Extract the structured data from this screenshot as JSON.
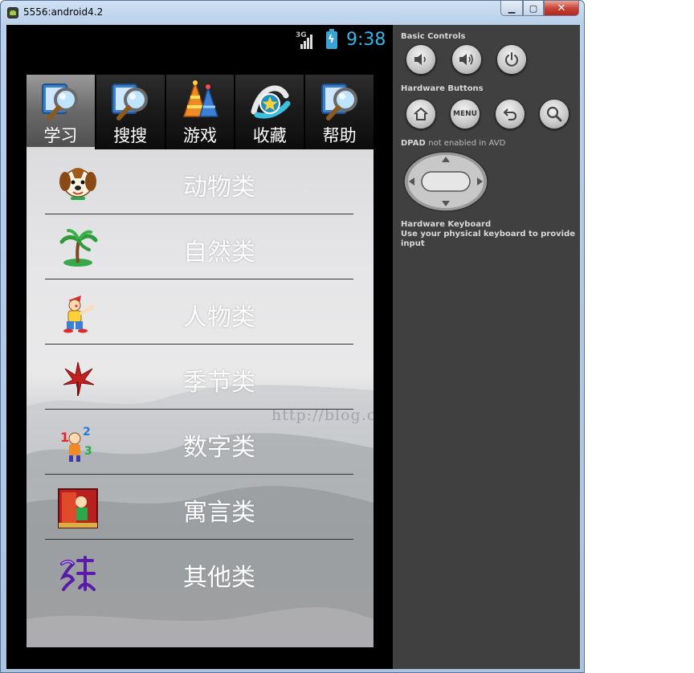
{
  "window": {
    "title": "5556:android4.2",
    "minimize_glyph": "▁",
    "maximize_glyph": "▢",
    "close_glyph": "✕"
  },
  "statusbar": {
    "network": "3G",
    "battery_glyph": "ϟ",
    "time": "9:38"
  },
  "tabs": [
    {
      "label": "学习",
      "icon": "magnifier-book-icon",
      "active": true
    },
    {
      "label": "搜搜",
      "icon": "magnifier-book-icon",
      "active": false
    },
    {
      "label": "游戏",
      "icon": "party-hat-icon",
      "active": false
    },
    {
      "label": "收藏",
      "icon": "star-swirl-icon",
      "active": false
    },
    {
      "label": "帮助",
      "icon": "magnifier-book-icon",
      "active": false
    }
  ],
  "categories": [
    {
      "label": "动物类",
      "icon": "puppy-icon"
    },
    {
      "label": "自然类",
      "icon": "palm-tree-icon"
    },
    {
      "label": "人物类",
      "icon": "clown-icon"
    },
    {
      "label": "季节类",
      "icon": "red-leaf-icon"
    },
    {
      "label": "数字类",
      "icon": "numbers-icon"
    },
    {
      "label": "寓言类",
      "icon": "fable-picture-icon"
    },
    {
      "label": "其他类",
      "icon": "calligraphy-icon"
    }
  ],
  "watermark": "http://blog.csdn.net/",
  "controls": {
    "basic_title": "Basic Controls",
    "hardware_title": "Hardware Buttons",
    "menu_label": "MENU",
    "dpad_title": "DPAD",
    "dpad_note": "not enabled in AVD",
    "keyboard_title": "Hardware Keyboard",
    "keyboard_note": "Use your physical keyboard to provide input"
  },
  "colors": {
    "clock": "#33b5e5",
    "control_panel": "#404040",
    "active_tab": "#6a6a6a"
  }
}
